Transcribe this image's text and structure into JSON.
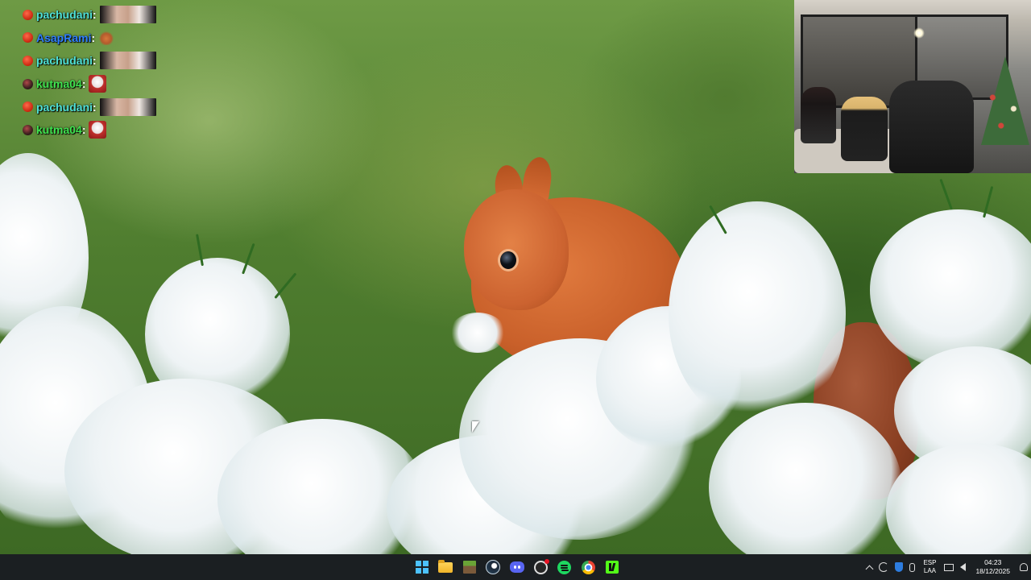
{
  "chat": {
    "messages": [
      {
        "user": "pachudani",
        "color": "#4fe0d6",
        "badge": "red",
        "emote": "face-emote"
      },
      {
        "user": "AsapRami",
        "color": "#2f7fff",
        "badge": "red",
        "emote": "small-animal-emote"
      },
      {
        "user": "pachudani",
        "color": "#4fe0d6",
        "badge": "red",
        "emote": "face-emote"
      },
      {
        "user": "kutma04",
        "color": "#3fe34f",
        "badge": "dark",
        "emote": "santa-emote"
      },
      {
        "user": "pachudani",
        "color": "#4fe0d6",
        "badge": "red",
        "emote": "face-emote"
      },
      {
        "user": "kutma04",
        "color": "#3fe34f",
        "badge": "dark",
        "emote": "santa-emote"
      }
    ],
    "colon": ":"
  },
  "taskbar": {
    "apps": [
      "windows-start",
      "file-explorer",
      "minecraft",
      "steam",
      "discord",
      "obs",
      "spotify",
      "chrome",
      "kick"
    ],
    "tray": {
      "lang_top": "ESP",
      "lang_bottom": "LAA",
      "time": "04:23",
      "date": "18/12/2025"
    }
  },
  "colors": {
    "taskbar_bg": "#1b1f22",
    "windows_accent": "#4cc2ff"
  }
}
